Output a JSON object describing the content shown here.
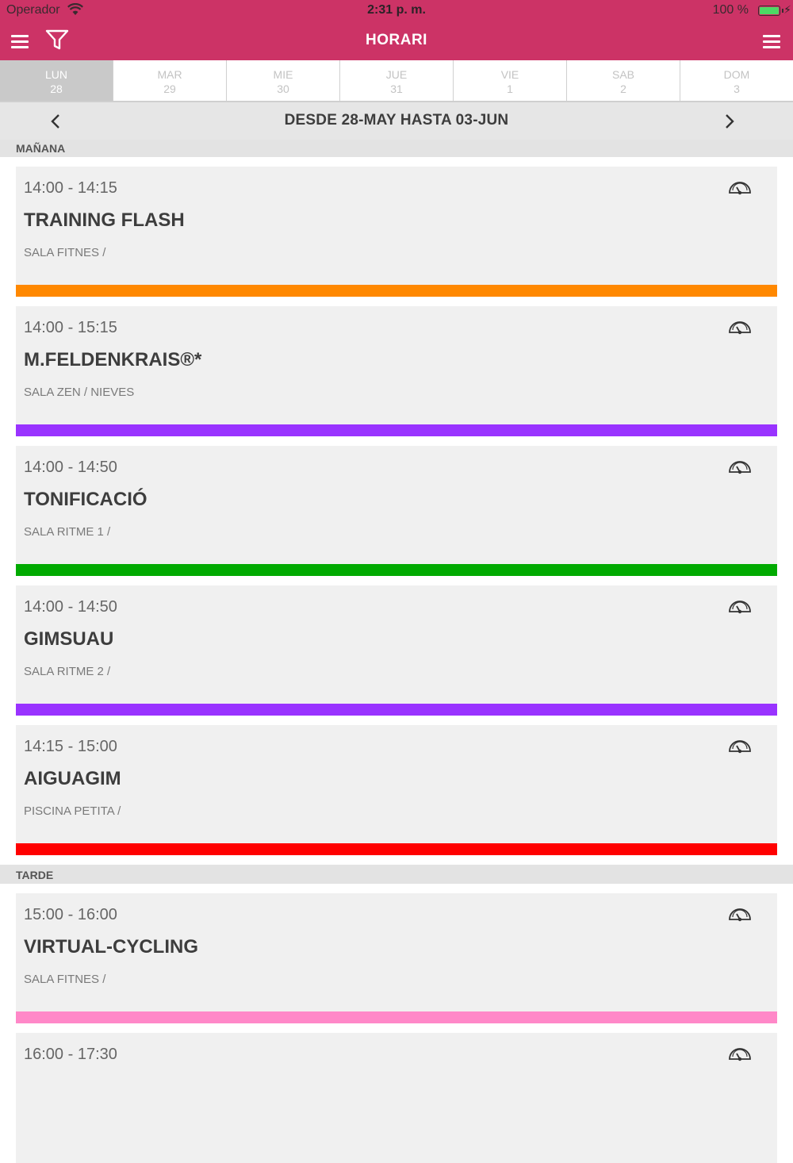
{
  "status_bar": {
    "carrier": "Operador",
    "time": "2:31 p. m.",
    "battery": "100 %"
  },
  "navbar": {
    "title": "HORARI"
  },
  "days": [
    {
      "dow": "LUN",
      "date": "28",
      "active": true
    },
    {
      "dow": "MAR",
      "date": "29"
    },
    {
      "dow": "MIE",
      "date": "30"
    },
    {
      "dow": "JUE",
      "date": "31"
    },
    {
      "dow": "VIE",
      "date": "1"
    },
    {
      "dow": "SAB",
      "date": "2"
    },
    {
      "dow": "DOM",
      "date": "3"
    }
  ],
  "range": {
    "label": "DESDE 28-MAY HASTA 03-JUN"
  },
  "sections": {
    "morning": "MAÑANA",
    "afternoon": "TARDE"
  },
  "classes": [
    {
      "time": "14:00 - 14:15",
      "name": "TRAINING FLASH",
      "room": "SALA FITNES /",
      "color": "#ff8800"
    },
    {
      "time": "14:00 - 15:15",
      "name": "M.FELDENKRAIS®*",
      "room": "SALA ZEN / NIEVES",
      "color": "#9933ff"
    },
    {
      "time": "14:00 - 14:50",
      "name": "TONIFICACIÓ",
      "room": "SALA RITME 1 /",
      "color": "#00aa00"
    },
    {
      "time": "14:00 - 14:50",
      "name": "GIMSUAU",
      "room": "SALA RITME 2 /",
      "color": "#9933ff"
    },
    {
      "time": "14:15 - 15:00",
      "name": "AIGUAGIM",
      "room": "PISCINA PETITA /",
      "color": "#ff0000"
    },
    {
      "time": "15:00 - 16:00",
      "name": "VIRTUAL-CYCLING",
      "room": "SALA FITNES /",
      "color": "#ff88c8"
    },
    {
      "time": "16:00 - 17:30",
      "name": "",
      "room": "",
      "color": "#f0f0f0"
    }
  ],
  "icons": {
    "menu": "hamburger-icon",
    "filter": "filter-icon",
    "prev": "chevron-left-icon",
    "next": "chevron-right-icon",
    "intensity": "gauge-icon"
  },
  "colors": {
    "brand": "#cc3366"
  }
}
